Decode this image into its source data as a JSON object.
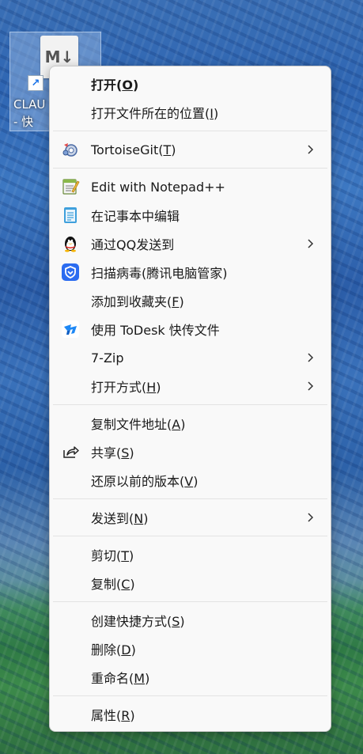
{
  "desktop": {
    "icon_badge": "M↓",
    "icon_label_line1": "CLAU",
    "icon_label_line2": "- 快"
  },
  "menu": {
    "groups": [
      [
        {
          "name": "open",
          "icon": "",
          "label": "打开(O)",
          "bold": true,
          "submenu": false
        },
        {
          "name": "open-file-location",
          "icon": "",
          "label": "打开文件所在的位置(I)",
          "bold": false,
          "submenu": false
        }
      ],
      [
        {
          "name": "tortoisegit",
          "icon": "tortoisegit-icon",
          "label": "TortoiseGit(T)",
          "bold": false,
          "submenu": true
        }
      ],
      [
        {
          "name": "edit-with-notepad-plus",
          "icon": "notepad-plus-plus-icon",
          "label": "Edit with Notepad++",
          "bold": false,
          "submenu": false
        },
        {
          "name": "edit-in-notepad",
          "icon": "notepad-icon",
          "label": "在记事本中编辑",
          "bold": false,
          "submenu": false
        },
        {
          "name": "send-via-qq",
          "icon": "qq-penguin-icon",
          "label": "通过QQ发送到",
          "bold": false,
          "submenu": true
        },
        {
          "name": "virus-scan",
          "icon": "tencent-pc-manager-icon",
          "label": "扫描病毒(腾讯电脑管家)",
          "bold": false,
          "submenu": false
        },
        {
          "name": "add-to-favorites",
          "icon": "",
          "label": "添加到收藏夹(F)",
          "bold": false,
          "submenu": false
        },
        {
          "name": "todesk-transfer",
          "icon": "todesk-icon",
          "label": "使用 ToDesk 快传文件",
          "bold": false,
          "submenu": false
        },
        {
          "name": "7zip",
          "icon": "",
          "label": "7-Zip",
          "bold": false,
          "submenu": true
        },
        {
          "name": "open-with",
          "icon": "",
          "label": "打开方式(H)",
          "bold": false,
          "submenu": true
        }
      ],
      [
        {
          "name": "copy-file-path",
          "icon": "",
          "label": "复制文件地址(A)",
          "bold": false,
          "submenu": false
        },
        {
          "name": "share",
          "icon": "share-icon",
          "label": "共享(S)",
          "bold": false,
          "submenu": false
        },
        {
          "name": "restore-previous-versions",
          "icon": "",
          "label": "还原以前的版本(V)",
          "bold": false,
          "submenu": false
        }
      ],
      [
        {
          "name": "send-to",
          "icon": "",
          "label": "发送到(N)",
          "bold": false,
          "submenu": true
        }
      ],
      [
        {
          "name": "cut",
          "icon": "",
          "label": "剪切(T)",
          "bold": false,
          "submenu": false
        },
        {
          "name": "copy",
          "icon": "",
          "label": "复制(C)",
          "bold": false,
          "submenu": false
        }
      ],
      [
        {
          "name": "create-shortcut",
          "icon": "",
          "label": "创建快捷方式(S)",
          "bold": false,
          "submenu": false
        },
        {
          "name": "delete",
          "icon": "",
          "label": "删除(D)",
          "bold": false,
          "submenu": false
        },
        {
          "name": "rename",
          "icon": "",
          "label": "重命名(M)",
          "bold": false,
          "submenu": false
        }
      ],
      [
        {
          "name": "properties",
          "icon": "",
          "label": "属性(R)",
          "bold": false,
          "submenu": false
        }
      ]
    ]
  },
  "colors": {
    "menu_background": "#f9f9f9",
    "separator": "#e3e3e3",
    "text": "#1a1a1a"
  }
}
